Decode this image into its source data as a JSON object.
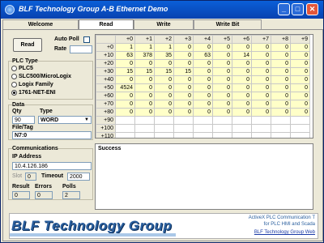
{
  "window": {
    "title": "BLF Technology Group A-B Ethernet Demo",
    "minimize_label": "_",
    "maximize_label": "□",
    "close_label": "✕"
  },
  "tabs": [
    {
      "label": "Welcome"
    },
    {
      "label": "Read",
      "active": true
    },
    {
      "label": "Write"
    },
    {
      "label": "Write Bit"
    }
  ],
  "read_panel": {
    "read_button": "Read",
    "auto_poll_label": "Auto Poll",
    "auto_poll_checked": false,
    "rate_label": "Rate",
    "rate_value": ""
  },
  "plc_type": {
    "title": "PLC Type",
    "options": [
      {
        "label": "PLC5",
        "selected": false
      },
      {
        "label": "SLC500/MicroLogix",
        "selected": false
      },
      {
        "label": "Logix Family",
        "selected": false
      },
      {
        "label": "1761-NET-ENI",
        "selected": true
      }
    ]
  },
  "data_group": {
    "title": "Data",
    "qty_label": "Qty",
    "type_label": "Type",
    "qty_value": "90",
    "type_value": "WORD",
    "file_tag_label": "File/Tag",
    "file_tag_value": "N7:0"
  },
  "communications": {
    "title": "Communications",
    "ip_label": "IP Address",
    "ip_value": "10.4.126.186",
    "slot_label": "Slot",
    "slot_value": "0",
    "timeout_label": "Timeout",
    "timeout_value": "2000",
    "result_label": "Result",
    "errors_label": "Errors",
    "polls_label": "Polls",
    "result_value": "0",
    "errors_value": "0",
    "polls_value": "2"
  },
  "data_grid": {
    "columns": [
      "+0",
      "+1",
      "+2",
      "+3",
      "+4",
      "+5",
      "+6",
      "+7",
      "+8",
      "+9"
    ],
    "rows": [
      {
        "label": "+0",
        "values": [
          "1",
          "1",
          "1",
          "0",
          "0",
          "0",
          "0",
          "0",
          "0",
          "0"
        ]
      },
      {
        "label": "+10",
        "values": [
          "63",
          "378",
          "35",
          "0",
          "63",
          "0",
          "14",
          "0",
          "0",
          "0"
        ]
      },
      {
        "label": "+20",
        "values": [
          "0",
          "0",
          "0",
          "0",
          "0",
          "0",
          "0",
          "0",
          "0",
          "0"
        ]
      },
      {
        "label": "+30",
        "values": [
          "15",
          "15",
          "15",
          "15",
          "0",
          "0",
          "0",
          "0",
          "0",
          "0"
        ]
      },
      {
        "label": "+40",
        "values": [
          "0",
          "0",
          "0",
          "0",
          "0",
          "0",
          "0",
          "0",
          "0",
          "0"
        ]
      },
      {
        "label": "+50",
        "values": [
          "4524",
          "0",
          "0",
          "0",
          "0",
          "0",
          "0",
          "0",
          "0",
          "0"
        ]
      },
      {
        "label": "+60",
        "values": [
          "0",
          "0",
          "0",
          "0",
          "0",
          "0",
          "0",
          "0",
          "0",
          "0"
        ]
      },
      {
        "label": "+70",
        "values": [
          "0",
          "0",
          "0",
          "0",
          "0",
          "0",
          "0",
          "0",
          "0",
          "0"
        ]
      },
      {
        "label": "+80",
        "values": [
          "0",
          "0",
          "0",
          "0",
          "0",
          "0",
          "0",
          "0",
          "0",
          "0"
        ]
      },
      {
        "label": "+90",
        "values": [
          "",
          "",
          "",
          "",
          "",
          "",
          "",
          "",
          "",
          ""
        ]
      },
      {
        "label": "+100",
        "values": [
          "",
          "",
          "",
          "",
          "",
          "",
          "",
          "",
          "",
          ""
        ]
      },
      {
        "label": "+110",
        "values": [
          "",
          "",
          "",
          "",
          "",
          "",
          "",
          "",
          "",
          ""
        ]
      }
    ]
  },
  "status_text": "Success",
  "banner": {
    "logo_text": "BLF Technology Group",
    "tagline_1": "ActiveX PLC Communication T",
    "tagline_2": "for PLC HMI and Scada",
    "link_text": "BLF Technology Group Web"
  },
  "colors": {
    "title_bar": "#0842b0",
    "grid_cell": "#ffffc8",
    "logo": "#2a5f9e"
  }
}
